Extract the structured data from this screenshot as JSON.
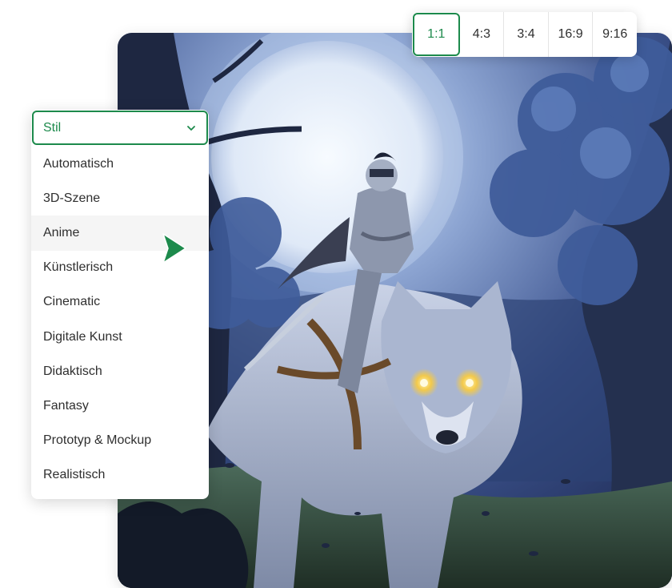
{
  "aspect_ratios": {
    "options": [
      "1:1",
      "4:3",
      "3:4",
      "16:9",
      "9:16"
    ],
    "selected": "1:1"
  },
  "style_dropdown": {
    "label": "Stil",
    "icon": "chevron-down-icon",
    "options": [
      "Automatisch",
      "3D-Szene",
      "Anime",
      "Künstlerisch",
      "Cinematic",
      "Digitale Kunst",
      "Didaktisch",
      "Fantasy",
      "Prototyp & Mockup",
      "Realistisch"
    ],
    "hovered": "Anime"
  },
  "cursor": {
    "icon": "pointer-arrow-icon"
  },
  "colors": {
    "accent": "#1d8a4c",
    "text": "#2f2f2f",
    "hover_bg": "#f5f5f5",
    "divider": "#e4e4e4"
  }
}
